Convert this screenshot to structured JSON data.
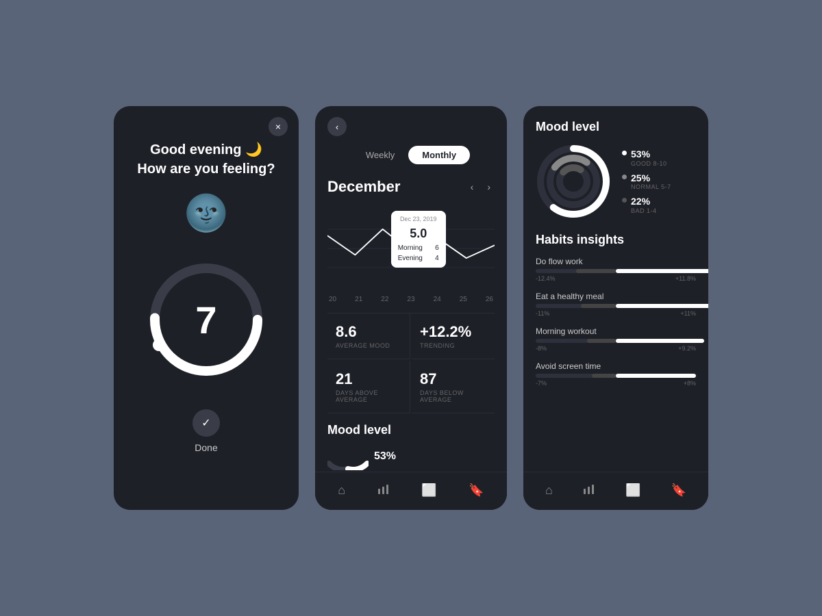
{
  "background": "#5a6478",
  "screen1": {
    "greeting_line1": "Good evening 🌙",
    "greeting_line2": "How are you feeling?",
    "dial_value": "7",
    "done_label": "Done",
    "close_label": "×"
  },
  "screen2": {
    "back_label": "‹",
    "tabs": [
      {
        "label": "Weekly",
        "active": false
      },
      {
        "label": "Monthly",
        "active": true
      }
    ],
    "month": "December",
    "chart": {
      "labels": [
        "20",
        "21",
        "22",
        "23",
        "24",
        "25",
        "26"
      ],
      "tooltip": {
        "date": "Dec 23, 2019",
        "value": "5.0",
        "morning_label": "Morning",
        "morning_value": "6",
        "evening_label": "Evening",
        "evening_value": "4"
      }
    },
    "stats": [
      {
        "value": "8.6",
        "label": "AVERAGE MOOD"
      },
      {
        "value": "+12.2%",
        "label": "TRENDING"
      },
      {
        "value": "21",
        "label": "DAYS ABOVE AVERAGE"
      },
      {
        "value": "87",
        "label": "DAYS BELOW AVERAGE"
      }
    ],
    "mood_level_title": "Mood level",
    "mood_percent": "53%",
    "nav": {
      "home_label": "⌂",
      "stats_label": "⍢",
      "calendar_label": "▭",
      "bookmark_label": "⌕"
    }
  },
  "screen3": {
    "mood_title": "Mood level",
    "donut": {
      "segments": [
        {
          "pct": 53,
          "label": "53%",
          "sublabel": "GOOD 8-10",
          "color": "#ffffff",
          "offset": 0
        },
        {
          "pct": 25,
          "label": "25%",
          "sublabel": "NORMAL 5-7",
          "color": "#888888",
          "offset": 53
        },
        {
          "pct": 22,
          "label": "22%",
          "sublabel": "BAD 1-4",
          "color": "#444444",
          "offset": 78
        }
      ]
    },
    "habits_title": "Habits insights",
    "habits": [
      {
        "name": "Do flow work",
        "neg": "-12.4%",
        "pos": "+11.8%",
        "neg_width": 25,
        "pos_width": 70
      },
      {
        "name": "Eat a healthy meal",
        "neg": "-11%",
        "pos": "+11%",
        "neg_width": 22,
        "pos_width": 65
      },
      {
        "name": "Morning workout",
        "neg": "-8%",
        "pos": "+9.2%",
        "neg_width": 18,
        "pos_width": 55
      },
      {
        "name": "Avoid screen time",
        "neg": "-7%",
        "pos": "+8%",
        "neg_width": 15,
        "pos_width": 50
      }
    ],
    "nav": {
      "home_label": "⌂",
      "stats_label": "⍢",
      "calendar_label": "▭",
      "bookmark_label": "⌕"
    }
  }
}
